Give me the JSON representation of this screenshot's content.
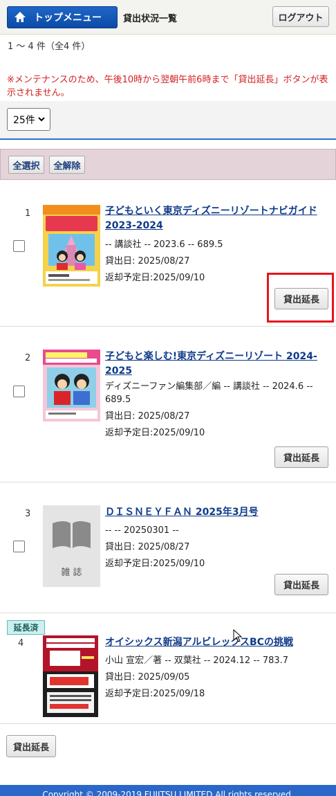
{
  "header": {
    "home_label": "トップメニュー",
    "page_title": "貸出状況一覧",
    "logout_label": "ログアウト"
  },
  "summary": {
    "count_text": "1 ～ 4 件（全4 件）",
    "notice": "※メンテナンスのため、午後10時から翌朝午前6時まで「貸出延長」ボタンが表示されません。"
  },
  "per_page": {
    "selected": "25件"
  },
  "bulk_actions": {
    "select_all": "全選択",
    "deselect_all": "全解除"
  },
  "items": [
    {
      "number": "1",
      "title": "子どもといく東京ディズニーリゾートナビガイド 2023-2024",
      "publisher_line": "-- 講談社 -- 2023.6 -- 689.5",
      "loan_date": "貸出日: 2025/08/27",
      "due_date": "返却予定日:2025/09/10",
      "extend_label": "貸出延長",
      "cover": {
        "top_text": "子どもといく",
        "title_text": "東京ディズニーリゾート",
        "sub_text": "ナビガイド"
      }
    },
    {
      "number": "2",
      "title": "子どもと楽しむ!東京ディズニーリゾート 2024-2025",
      "publisher_line": "ディズニーファン編集部／編 -- 講談社 -- 2024.6 -- 689.5",
      "loan_date": "貸出日: 2025/08/27",
      "due_date": "返却予定日:2025/09/10",
      "extend_label": "貸出延長",
      "cover": {
        "title_text": "子どもと楽しむ!",
        "sub_text": "東京ディズニーリゾート"
      }
    },
    {
      "number": "3",
      "title": "ＤＩＳＮＥＹＦＡＮ 2025年3月号",
      "publisher_line": "-- -- 20250301 --",
      "loan_date": "貸出日: 2025/08/27",
      "due_date": "返却予定日:2025/09/10",
      "extend_label": "貸出延長",
      "cover": {
        "placeholder_label": "雑 誌"
      }
    },
    {
      "number": "4",
      "badge": "延長済",
      "title": "オイシックス新潟アルビレックスBCの挑戦",
      "publisher_line": "小山 宣宏／著 -- 双葉社 -- 2024.12 -- 783.7",
      "loan_date": "貸出日: 2025/09/05",
      "due_date": "返却予定日:2025/09/18",
      "cover": {
        "top_text": "オイシックス新潟",
        "top_text2": "アルビレックスBCの",
        "big_text": "挑戦",
        "logo_text": "Oisix",
        "bottom_text": "初めての挑戦だ!"
      }
    }
  ],
  "bottom_extend_label": "貸出延長",
  "footer": {
    "copyright": "Copyright © 2009-2019 FUJITSU LIMITED All rights reserved."
  },
  "colors": {
    "accent": "#2b67c9",
    "notice": "#d42020",
    "highlight": "#e8141c",
    "link": "#0f3a8a"
  }
}
